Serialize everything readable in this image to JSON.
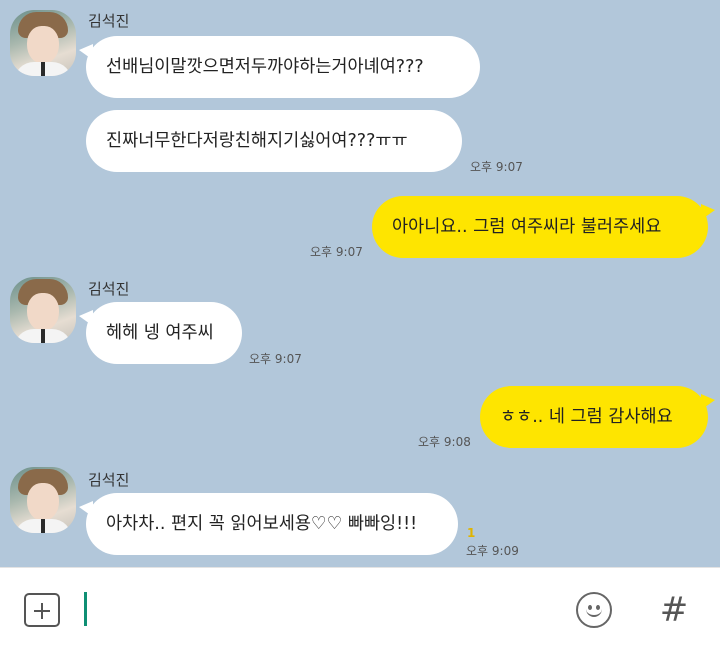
{
  "sender": {
    "name": "김석진"
  },
  "messages": [
    {
      "dir": "in",
      "text": "선배님이말깟으면저두까야하는거아녜여???"
    },
    {
      "dir": "in",
      "text": "진짜너무한다저랑친해지기싫어여???ㅠㅠ",
      "time": "오후 9:07"
    },
    {
      "dir": "out",
      "text": "아아니요.. 그럼 여주씨라 불러주세요",
      "time": "오후 9:07"
    },
    {
      "dir": "in",
      "text": "헤헤 넹 여주씨",
      "time": "오후 9:07"
    },
    {
      "dir": "out",
      "text": "ㅎㅎ.. 네 그럼 감사해요",
      "time": "오후 9:08"
    },
    {
      "dir": "in",
      "text": "아차차.. 편지 꼭 읽어보세용♡♡ 빠빠잉!!!",
      "time": "오후 9:09",
      "unread": "1"
    }
  ],
  "input": {
    "placeholder": ""
  },
  "icons": {
    "attach": "plus-square-icon",
    "emoji": "smiley-icon",
    "hashtag": "hashtag-icon"
  },
  "colors": {
    "background": "#b2c7da",
    "incoming_bubble": "#ffffff",
    "outgoing_bubble": "#fee500",
    "caret": "#0f8f74"
  }
}
